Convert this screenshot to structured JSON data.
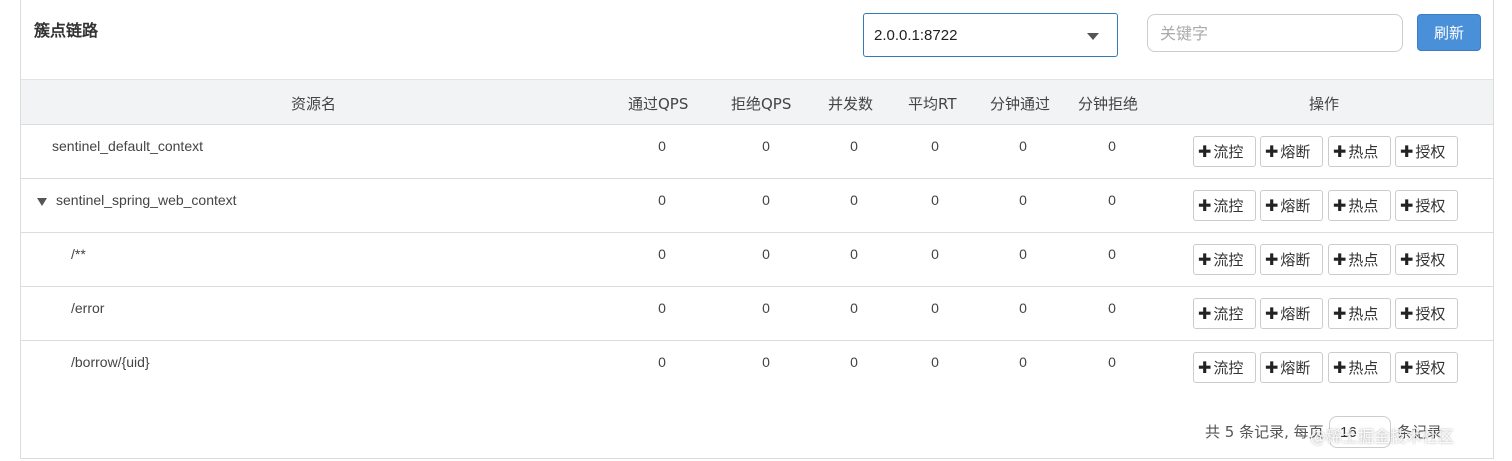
{
  "header": {
    "title": "簇点链路",
    "machine_select": "2.0.0.1:8722",
    "search_placeholder": "关键字",
    "refresh_label": "刷新"
  },
  "columns": {
    "resource": "资源名",
    "pass_qps": "通过QPS",
    "block_qps": "拒绝QPS",
    "concurrency": "并发数",
    "avg_rt": "平均RT",
    "minute_pass": "分钟通过",
    "minute_block": "分钟拒绝",
    "ops": "操作"
  },
  "action_labels": [
    "流控",
    "熔断",
    "热点",
    "授权"
  ],
  "rows": [
    {
      "name": "sentinel_default_context",
      "pass_qps": "0",
      "block_qps": "0",
      "concurrency": "0",
      "avg_rt": "0",
      "minute_pass": "0",
      "minute_block": "0"
    },
    {
      "name": "sentinel_spring_web_context",
      "pass_qps": "0",
      "block_qps": "0",
      "concurrency": "0",
      "avg_rt": "0",
      "minute_pass": "0",
      "minute_block": "0"
    },
    {
      "name": "/**",
      "pass_qps": "0",
      "block_qps": "0",
      "concurrency": "0",
      "avg_rt": "0",
      "minute_pass": "0",
      "minute_block": "0"
    },
    {
      "name": "/error",
      "pass_qps": "0",
      "block_qps": "0",
      "concurrency": "0",
      "avg_rt": "0",
      "minute_pass": "0",
      "minute_block": "0"
    },
    {
      "name": "/borrow/{uid}",
      "pass_qps": "0",
      "block_qps": "0",
      "concurrency": "0",
      "avg_rt": "0",
      "minute_pass": "0",
      "minute_block": "0"
    }
  ],
  "footer": {
    "summary": "共 5 条记录, 每页",
    "page_size": "16",
    "unit": "条记录"
  },
  "watermark": "@稀土掘金技术社区"
}
